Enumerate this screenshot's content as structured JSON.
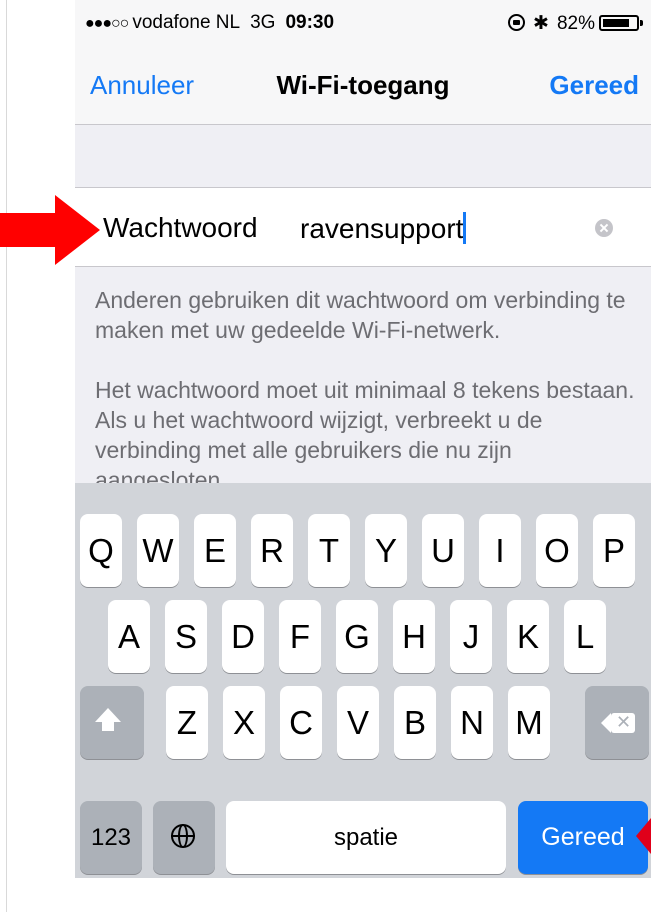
{
  "status_bar": {
    "signal": "●●●○○",
    "carrier": "vodafone NL",
    "network": "3G",
    "time": "09:30",
    "bluetooth": "✱",
    "battery_percent": "82%",
    "battery_level": 0.82
  },
  "nav": {
    "cancel_label": "Annuleer",
    "title": "Wi-Fi-toegang",
    "done_label": "Gereed"
  },
  "password": {
    "label": "Wachtwoord",
    "value": "ravensupport"
  },
  "footer": {
    "paragraph_1": "Anderen gebruiken dit wachtwoord om verbinding te maken met uw gedeelde Wi-Fi-netwerk.",
    "paragraph_2": "Het wachtwoord moet uit minimaal 8 tekens bestaan. Als u het wachtwoord wijzigt, verbreekt u de verbinding met alle gebruikers die nu zijn aangesloten."
  },
  "keyboard": {
    "row1": [
      "Q",
      "W",
      "E",
      "R",
      "T",
      "Y",
      "U",
      "I",
      "O",
      "P"
    ],
    "row2": [
      "A",
      "S",
      "D",
      "F",
      "G",
      "H",
      "J",
      "K",
      "L"
    ],
    "row3": [
      "Z",
      "X",
      "C",
      "V",
      "B",
      "N",
      "M"
    ],
    "shift_icon": "shift-icon",
    "backspace_icon": "backspace-icon",
    "numbers_label": "123",
    "globe_icon": "globe-icon",
    "space_label": "spatie",
    "return_label": "Gereed"
  },
  "colors": {
    "accent": "#1479f5",
    "annotation_arrow": "#ff0000"
  }
}
